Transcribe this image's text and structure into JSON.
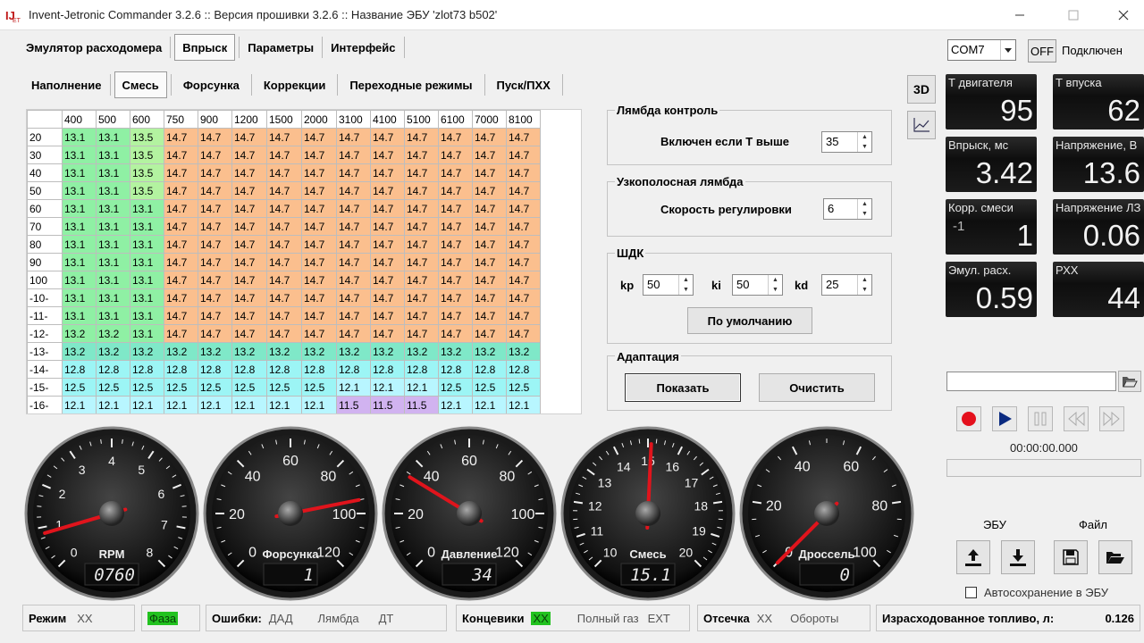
{
  "window": {
    "title": "Invent-Jetronic Commander 3.2.6 :: Версия прошивки 3.2.6 :: Название ЭБУ 'zlot73 b502'"
  },
  "main_tabs": [
    {
      "label": "Эмулятор расходомера",
      "active": false
    },
    {
      "label": "Впрыск",
      "active": true
    },
    {
      "label": "Параметры",
      "active": false
    },
    {
      "label": "Интерфейс",
      "active": false
    }
  ],
  "sub_tabs": [
    {
      "label": "Наполнение",
      "active": false
    },
    {
      "label": "Смесь",
      "active": true
    },
    {
      "label": "Форсунка",
      "active": false
    },
    {
      "label": "Коррекции",
      "active": false
    },
    {
      "label": "Переходные режимы",
      "active": false
    },
    {
      "label": "Пуск/ПХХ",
      "active": false
    }
  ],
  "connection": {
    "port": "COM7",
    "off_label": "OFF",
    "status": "Подключен"
  },
  "side_buttons": {
    "view3d": "3D"
  },
  "grid": {
    "columns": [
      "400",
      "500",
      "600",
      "750",
      "900",
      "1200",
      "1500",
      "2000",
      "3100",
      "4100",
      "5100",
      "6100",
      "7000",
      "8100"
    ],
    "rows": [
      {
        "label": "20",
        "values": [
          "13.1",
          "13.1",
          "13.5",
          "14.7",
          "14.7",
          "14.7",
          "14.7",
          "14.7",
          "14.7",
          "14.7",
          "14.7",
          "14.7",
          "14.7",
          "14.7"
        ]
      },
      {
        "label": "30",
        "values": [
          "13.1",
          "13.1",
          "13.5",
          "14.7",
          "14.7",
          "14.7",
          "14.7",
          "14.7",
          "14.7",
          "14.7",
          "14.7",
          "14.7",
          "14.7",
          "14.7"
        ]
      },
      {
        "label": "40",
        "values": [
          "13.1",
          "13.1",
          "13.5",
          "14.7",
          "14.7",
          "14.7",
          "14.7",
          "14.7",
          "14.7",
          "14.7",
          "14.7",
          "14.7",
          "14.7",
          "14.7"
        ]
      },
      {
        "label": "50",
        "values": [
          "13.1",
          "13.1",
          "13.5",
          "14.7",
          "14.7",
          "14.7",
          "14.7",
          "14.7",
          "14.7",
          "14.7",
          "14.7",
          "14.7",
          "14.7",
          "14.7"
        ]
      },
      {
        "label": "60",
        "values": [
          "13.1",
          "13.1",
          "13.1",
          "14.7",
          "14.7",
          "14.7",
          "14.7",
          "14.7",
          "14.7",
          "14.7",
          "14.7",
          "14.7",
          "14.7",
          "14.7"
        ]
      },
      {
        "label": "70",
        "values": [
          "13.1",
          "13.1",
          "13.1",
          "14.7",
          "14.7",
          "14.7",
          "14.7",
          "14.7",
          "14.7",
          "14.7",
          "14.7",
          "14.7",
          "14.7",
          "14.7"
        ]
      },
      {
        "label": "80",
        "values": [
          "13.1",
          "13.1",
          "13.1",
          "14.7",
          "14.7",
          "14.7",
          "14.7",
          "14.7",
          "14.7",
          "14.7",
          "14.7",
          "14.7",
          "14.7",
          "14.7"
        ]
      },
      {
        "label": "90",
        "values": [
          "13.1",
          "13.1",
          "13.1",
          "14.7",
          "14.7",
          "14.7",
          "14.7",
          "14.7",
          "14.7",
          "14.7",
          "14.7",
          "14.7",
          "14.7",
          "14.7"
        ]
      },
      {
        "label": "100",
        "values": [
          "13.1",
          "13.1",
          "13.1",
          "14.7",
          "14.7",
          "14.7",
          "14.7",
          "14.7",
          "14.7",
          "14.7",
          "14.7",
          "14.7",
          "14.7",
          "14.7"
        ]
      },
      {
        "label": "-10-",
        "values": [
          "13.1",
          "13.1",
          "13.1",
          "14.7",
          "14.7",
          "14.7",
          "14.7",
          "14.7",
          "14.7",
          "14.7",
          "14.7",
          "14.7",
          "14.7",
          "14.7"
        ]
      },
      {
        "label": "-11-",
        "values": [
          "13.1",
          "13.1",
          "13.1",
          "14.7",
          "14.7",
          "14.7",
          "14.7",
          "14.7",
          "14.7",
          "14.7",
          "14.7",
          "14.7",
          "14.7",
          "14.7"
        ]
      },
      {
        "label": "-12-",
        "values": [
          "13.2",
          "13.2",
          "13.1",
          "14.7",
          "14.7",
          "14.7",
          "14.7",
          "14.7",
          "14.7",
          "14.7",
          "14.7",
          "14.7",
          "14.7",
          "14.7"
        ]
      },
      {
        "label": "-13-",
        "values": [
          "13.2",
          "13.2",
          "13.2",
          "13.2",
          "13.2",
          "13.2",
          "13.2",
          "13.2",
          "13.2",
          "13.2",
          "13.2",
          "13.2",
          "13.2",
          "13.2"
        ]
      },
      {
        "label": "-14-",
        "values": [
          "12.8",
          "12.8",
          "12.8",
          "12.8",
          "12.8",
          "12.8",
          "12.8",
          "12.8",
          "12.8",
          "12.8",
          "12.8",
          "12.8",
          "12.8",
          "12.8"
        ]
      },
      {
        "label": "-15-",
        "values": [
          "12.5",
          "12.5",
          "12.5",
          "12.5",
          "12.5",
          "12.5",
          "12.5",
          "12.5",
          "12.1",
          "12.1",
          "12.1",
          "12.5",
          "12.5",
          "12.5"
        ]
      },
      {
        "label": "-16-",
        "values": [
          "12.1",
          "12.1",
          "12.1",
          "12.1",
          "12.1",
          "12.1",
          "12.1",
          "12.1",
          "11.5",
          "11.5",
          "11.5",
          "12.1",
          "12.1",
          "12.1"
        ]
      }
    ]
  },
  "lambda_control": {
    "title": "Лямбда контроль",
    "label": "Включен если Т выше",
    "value": "35"
  },
  "narrow_lambda": {
    "title": "Узкополосная лямбда",
    "label": "Скорость регулировки",
    "value": "6"
  },
  "pid": {
    "title": "ШДК",
    "kp_label": "kp",
    "kp": "50",
    "ki_label": "ki",
    "ki": "50",
    "kd_label": "kd",
    "kd": "25",
    "default_button": "По умолчанию"
  },
  "adaptation": {
    "title": "Адаптация",
    "show_button": "Показать",
    "clear_button": "Очистить"
  },
  "readouts": [
    {
      "label": "Т двигателя",
      "sub": "",
      "value": "95"
    },
    {
      "label": "Т впуска",
      "sub": "",
      "value": "62"
    },
    {
      "label": "Впрыск, мс",
      "sub": "",
      "value": "3.42"
    },
    {
      "label": "Напряжение, В",
      "sub": "",
      "value": "13.6"
    },
    {
      "label": "Корр. смеси",
      "sub": "-1",
      "value": "1"
    },
    {
      "label": "Напряжение ЛЗ",
      "sub": "",
      "value": "0.06"
    },
    {
      "label": "Эмул. расх.",
      "sub": "",
      "value": "0.59"
    },
    {
      "label": "РХХ",
      "sub": "",
      "value": "44"
    }
  ],
  "playback": {
    "time": "00:00:00.000"
  },
  "ecu_file": {
    "ecu_label": "ЭБУ",
    "file_label": "Файл",
    "autosave_label": "Автосохранение в ЭБУ",
    "autosave_checked": false
  },
  "gauges": [
    {
      "name": "RPM",
      "display": "0760",
      "labels": [
        "0",
        "1",
        "2",
        "3",
        "4",
        "5",
        "6",
        "7",
        "8"
      ],
      "value": 0.85,
      "max": 8
    },
    {
      "name": "Форсунка",
      "display": "1",
      "labels": [
        "0",
        "20",
        "40",
        "60",
        "80",
        "100",
        "120"
      ],
      "value": 95,
      "max": 120
    },
    {
      "name": "Давление",
      "display": "34",
      "labels": [
        "0",
        "20",
        "40",
        "60",
        "80",
        "100",
        "120"
      ],
      "value": 34,
      "max": 120
    },
    {
      "name": "Смесь",
      "display": "15.1",
      "labels": [
        "10",
        "11",
        "12",
        "13",
        "14",
        "15",
        "16",
        "17",
        "18",
        "19",
        "20"
      ],
      "value": 15.1,
      "min": 10,
      "max": 20
    },
    {
      "name": "Дроссель",
      "display": "0",
      "labels": [
        "0",
        "20",
        "40",
        "60",
        "80",
        "100"
      ],
      "value": 0,
      "max": 100
    }
  ],
  "status": {
    "mode_label": "Режим",
    "mode_value": "XX",
    "phase": "Фаза",
    "errors_label": "Ошибки:",
    "err1": "ДАД",
    "err2": "Лямбда",
    "err3": "ДТ",
    "limits_label": "Концевики",
    "limits_value": "XX",
    "full_gas": "Полный газ",
    "ext": "EXT",
    "cutoff_label": "Отсечка",
    "cutoff_value": "XX",
    "revs": "Обороты",
    "fuel_label": "Израсходованное топливо, л:",
    "fuel_value": "0.126"
  },
  "colors": {
    "green": "#8ff0a4",
    "lightgreen": "#b3f3a0",
    "orange": "#fbbf8e",
    "aqua": "#7fe8c8",
    "cyan": "#9cf5f5",
    "lightcyan": "#b8f6ff",
    "purple": "#d1b3f0"
  }
}
